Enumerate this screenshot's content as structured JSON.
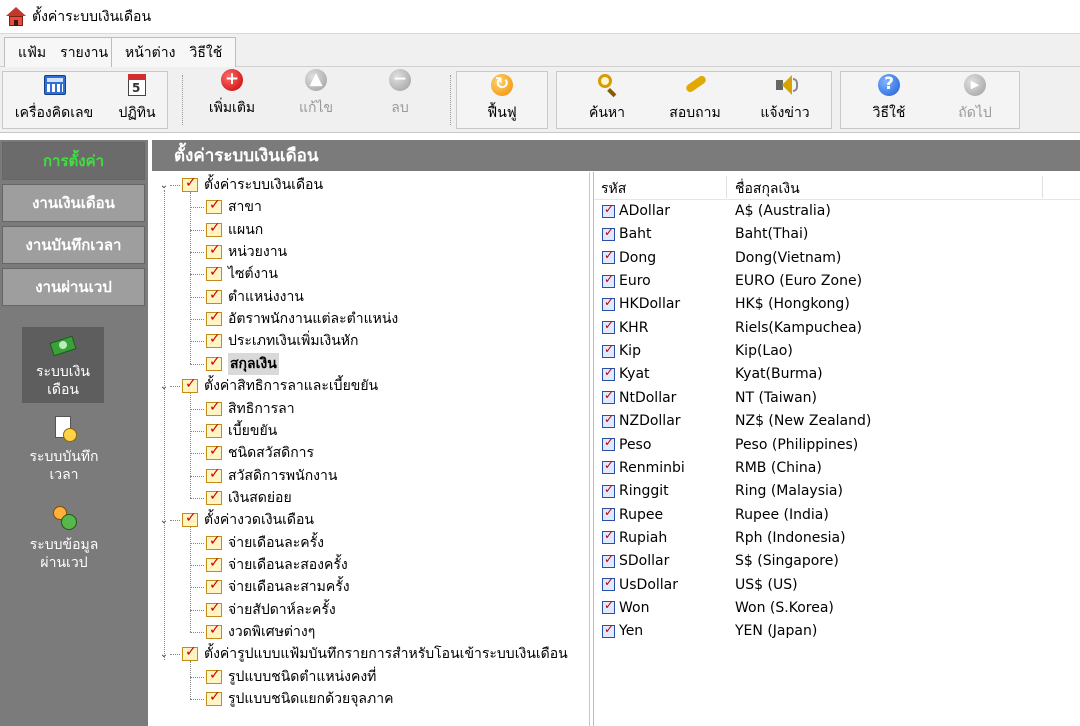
{
  "window": {
    "title": "ตั้งค่าระบบเงินเดือน"
  },
  "menubar": {
    "group1": [
      {
        "label": "แฟ้ม"
      },
      {
        "label": "รายงาน"
      }
    ],
    "group2": [
      {
        "label": "หน้าต่าง"
      },
      {
        "label": "วิธีใช้"
      }
    ]
  },
  "toolbar": {
    "calculator": "เครื่องคิดเลข",
    "calendar": "ปฏิทิน",
    "add": "เพิ่มเติม",
    "edit": "แก้ไข",
    "delete": "ลบ",
    "restore": "ฟื้นฟู",
    "search": "ค้นหา",
    "inquire": "สอบถาม",
    "announce": "แจ้งข่าว",
    "help": "วิธีใช้",
    "next": "ถัดไป"
  },
  "sidebar": {
    "tabs": [
      {
        "label": "การตั้งค่า"
      },
      {
        "label": "งานเงินเดือน"
      },
      {
        "label": "งานบันทึกเวลา"
      },
      {
        "label": "งานผ่านเวป"
      }
    ],
    "modules": [
      {
        "label1": "ระบบเงิน",
        "label2": "เดือน"
      },
      {
        "label1": "ระบบบันทึก",
        "label2": "เวลา"
      },
      {
        "label1": "ระบบข้อมูล",
        "label2": "ผ่านเวป"
      }
    ]
  },
  "content": {
    "title": "ตั้งค่าระบบเงินเดือน"
  },
  "tree": [
    {
      "label": "ตั้งค่าระบบเงินเดือน",
      "children": [
        {
          "label": "สาขา"
        },
        {
          "label": "แผนก"
        },
        {
          "label": "หน่วยงาน"
        },
        {
          "label": "ไซต์งาน"
        },
        {
          "label": "ตำแหน่งงาน"
        },
        {
          "label": "อัตราพนักงานแต่ละตำแหน่ง"
        },
        {
          "label": "ประเภทเงินเพิ่มเงินหัก"
        },
        {
          "label": "สกุลเงิน"
        }
      ]
    },
    {
      "label": "ตั้งค่าสิทธิการลาและเบี้ยขยัน",
      "children": [
        {
          "label": "สิทธิการลา"
        },
        {
          "label": "เบี้ยขยัน"
        },
        {
          "label": "ชนิดสวัสดิการ"
        },
        {
          "label": "สวัสดิการพนักงาน"
        },
        {
          "label": "เงินสดย่อย"
        }
      ]
    },
    {
      "label": "ตั้งค่างวดเงินเดือน",
      "children": [
        {
          "label": "จ่ายเดือนละครั้ง"
        },
        {
          "label": "จ่ายเดือนละสองครั้ง"
        },
        {
          "label": "จ่ายเดือนละสามครั้ง"
        },
        {
          "label": "จ่ายสัปดาห์ละครั้ง"
        },
        {
          "label": "งวดพิเศษต่างๆ"
        }
      ]
    },
    {
      "label": "ตั้งค่ารูปแบบแฟ้มบันทึกรายการสำหรับโอนเข้าระบบเงินเดือน",
      "children": [
        {
          "label": "รูปแบบชนิดตำแหน่งคงที่"
        },
        {
          "label": "รูปแบบชนิดแยกด้วยจุลภาค"
        }
      ]
    }
  ],
  "currency_list": {
    "headers": {
      "code": "รหัส",
      "name": "ชื่อสกุลเงิน"
    },
    "rows": [
      {
        "code": "ADollar",
        "name": "A$ (Australia)"
      },
      {
        "code": "Baht",
        "name": "Baht(Thai)"
      },
      {
        "code": "Dong",
        "name": "Dong(Vietnam)"
      },
      {
        "code": "Euro",
        "name": "EURO (Euro Zone)"
      },
      {
        "code": "HKDollar",
        "name": "HK$ (Hongkong)"
      },
      {
        "code": "KHR",
        "name": "Riels(Kampuchea)"
      },
      {
        "code": "Kip",
        "name": "Kip(Lao)"
      },
      {
        "code": "Kyat",
        "name": "Kyat(Burma)"
      },
      {
        "code": "NtDollar",
        "name": "NT (Taiwan)"
      },
      {
        "code": "NZDollar",
        "name": "NZ$ (New Zealand)"
      },
      {
        "code": "Peso",
        "name": "Peso (Philippines)"
      },
      {
        "code": "Renminbi",
        "name": "RMB (China)"
      },
      {
        "code": "Ringgit",
        "name": "Ring (Malaysia)"
      },
      {
        "code": "Rupee",
        "name": "Rupee (India)"
      },
      {
        "code": "Rupiah",
        "name": "Rph (Indonesia)"
      },
      {
        "code": "SDollar",
        "name": "S$ (Singapore)"
      },
      {
        "code": "UsDollar",
        "name": "US$ (US)"
      },
      {
        "code": "Won",
        "name": "Won (S.Korea)"
      },
      {
        "code": "Yen",
        "name": "YEN (Japan)"
      }
    ]
  },
  "colors": {
    "sidebar_bg": "#7b7b7b",
    "active_tab_text": "#3ee03e",
    "content_header_bg": "#7b7b7b"
  }
}
